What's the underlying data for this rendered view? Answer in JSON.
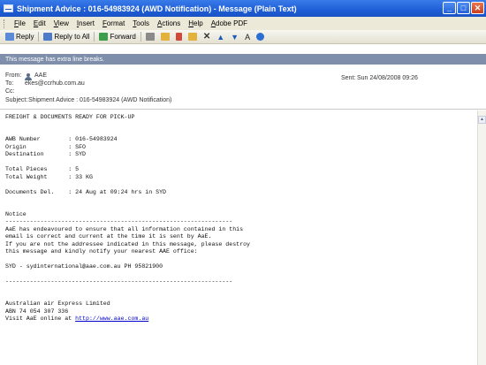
{
  "window": {
    "title": "Shipment Advice : 016-54983924 (AWD Notification) - Message (Plain Text)",
    "controls": {
      "minimize": "_",
      "maximize": "□",
      "close": "✕"
    }
  },
  "menu": [
    "File",
    "Edit",
    "View",
    "Insert",
    "Format",
    "Tools",
    "Actions",
    "Help",
    "Adobe PDF"
  ],
  "toolbar": {
    "reply": "Reply",
    "reply_all": "Reply to All",
    "forward": "Forward"
  },
  "infobar": "This message has extra line breaks.",
  "headers": {
    "from_label": "From:",
    "from_value": "AAE",
    "to_label": "To:",
    "to_value": "ekes@ccrhub.com.au",
    "cc_label": "Cc:",
    "cc_value": "",
    "subject_label": "Subject:",
    "subject_value": "Shipment Advice : 016-54983924 (AWD Notification)",
    "sent_label": "Sent:",
    "sent_value": "Sun 24/08/2008 09:26"
  },
  "body": {
    "lines": [
      "FREIGHT & DOCUMENTS READY FOR PICK-UP",
      "",
      "",
      "AWB Number        : 016-54983924",
      "Origin            : SFO",
      "Destination       : SYD",
      "",
      "Total Pieces      : 5",
      "Total Weight      : 33 KG",
      "",
      "Documents Del.    : 24 Aug at 09:24 hrs in SYD",
      "",
      "",
      "Notice",
      "-----------------------------------------------------------------",
      "AaE has endeavoured to ensure that all information contained in this",
      "email is correct and current at the time it is sent by AaE.",
      "If you are not the addressee indicated in this message, please destroy",
      "this message and kindly notify your nearest AAE office:",
      "",
      "SYD - sydinternational@aae.com.au PH 95821900",
      "",
      "-----------------------------------------------------------------",
      "",
      "",
      "Australian air Express Limited",
      "ABN 74 054 307 336"
    ],
    "last_line_prefix": "Visit AaE online at ",
    "link": "http://www.aae.com.au"
  }
}
